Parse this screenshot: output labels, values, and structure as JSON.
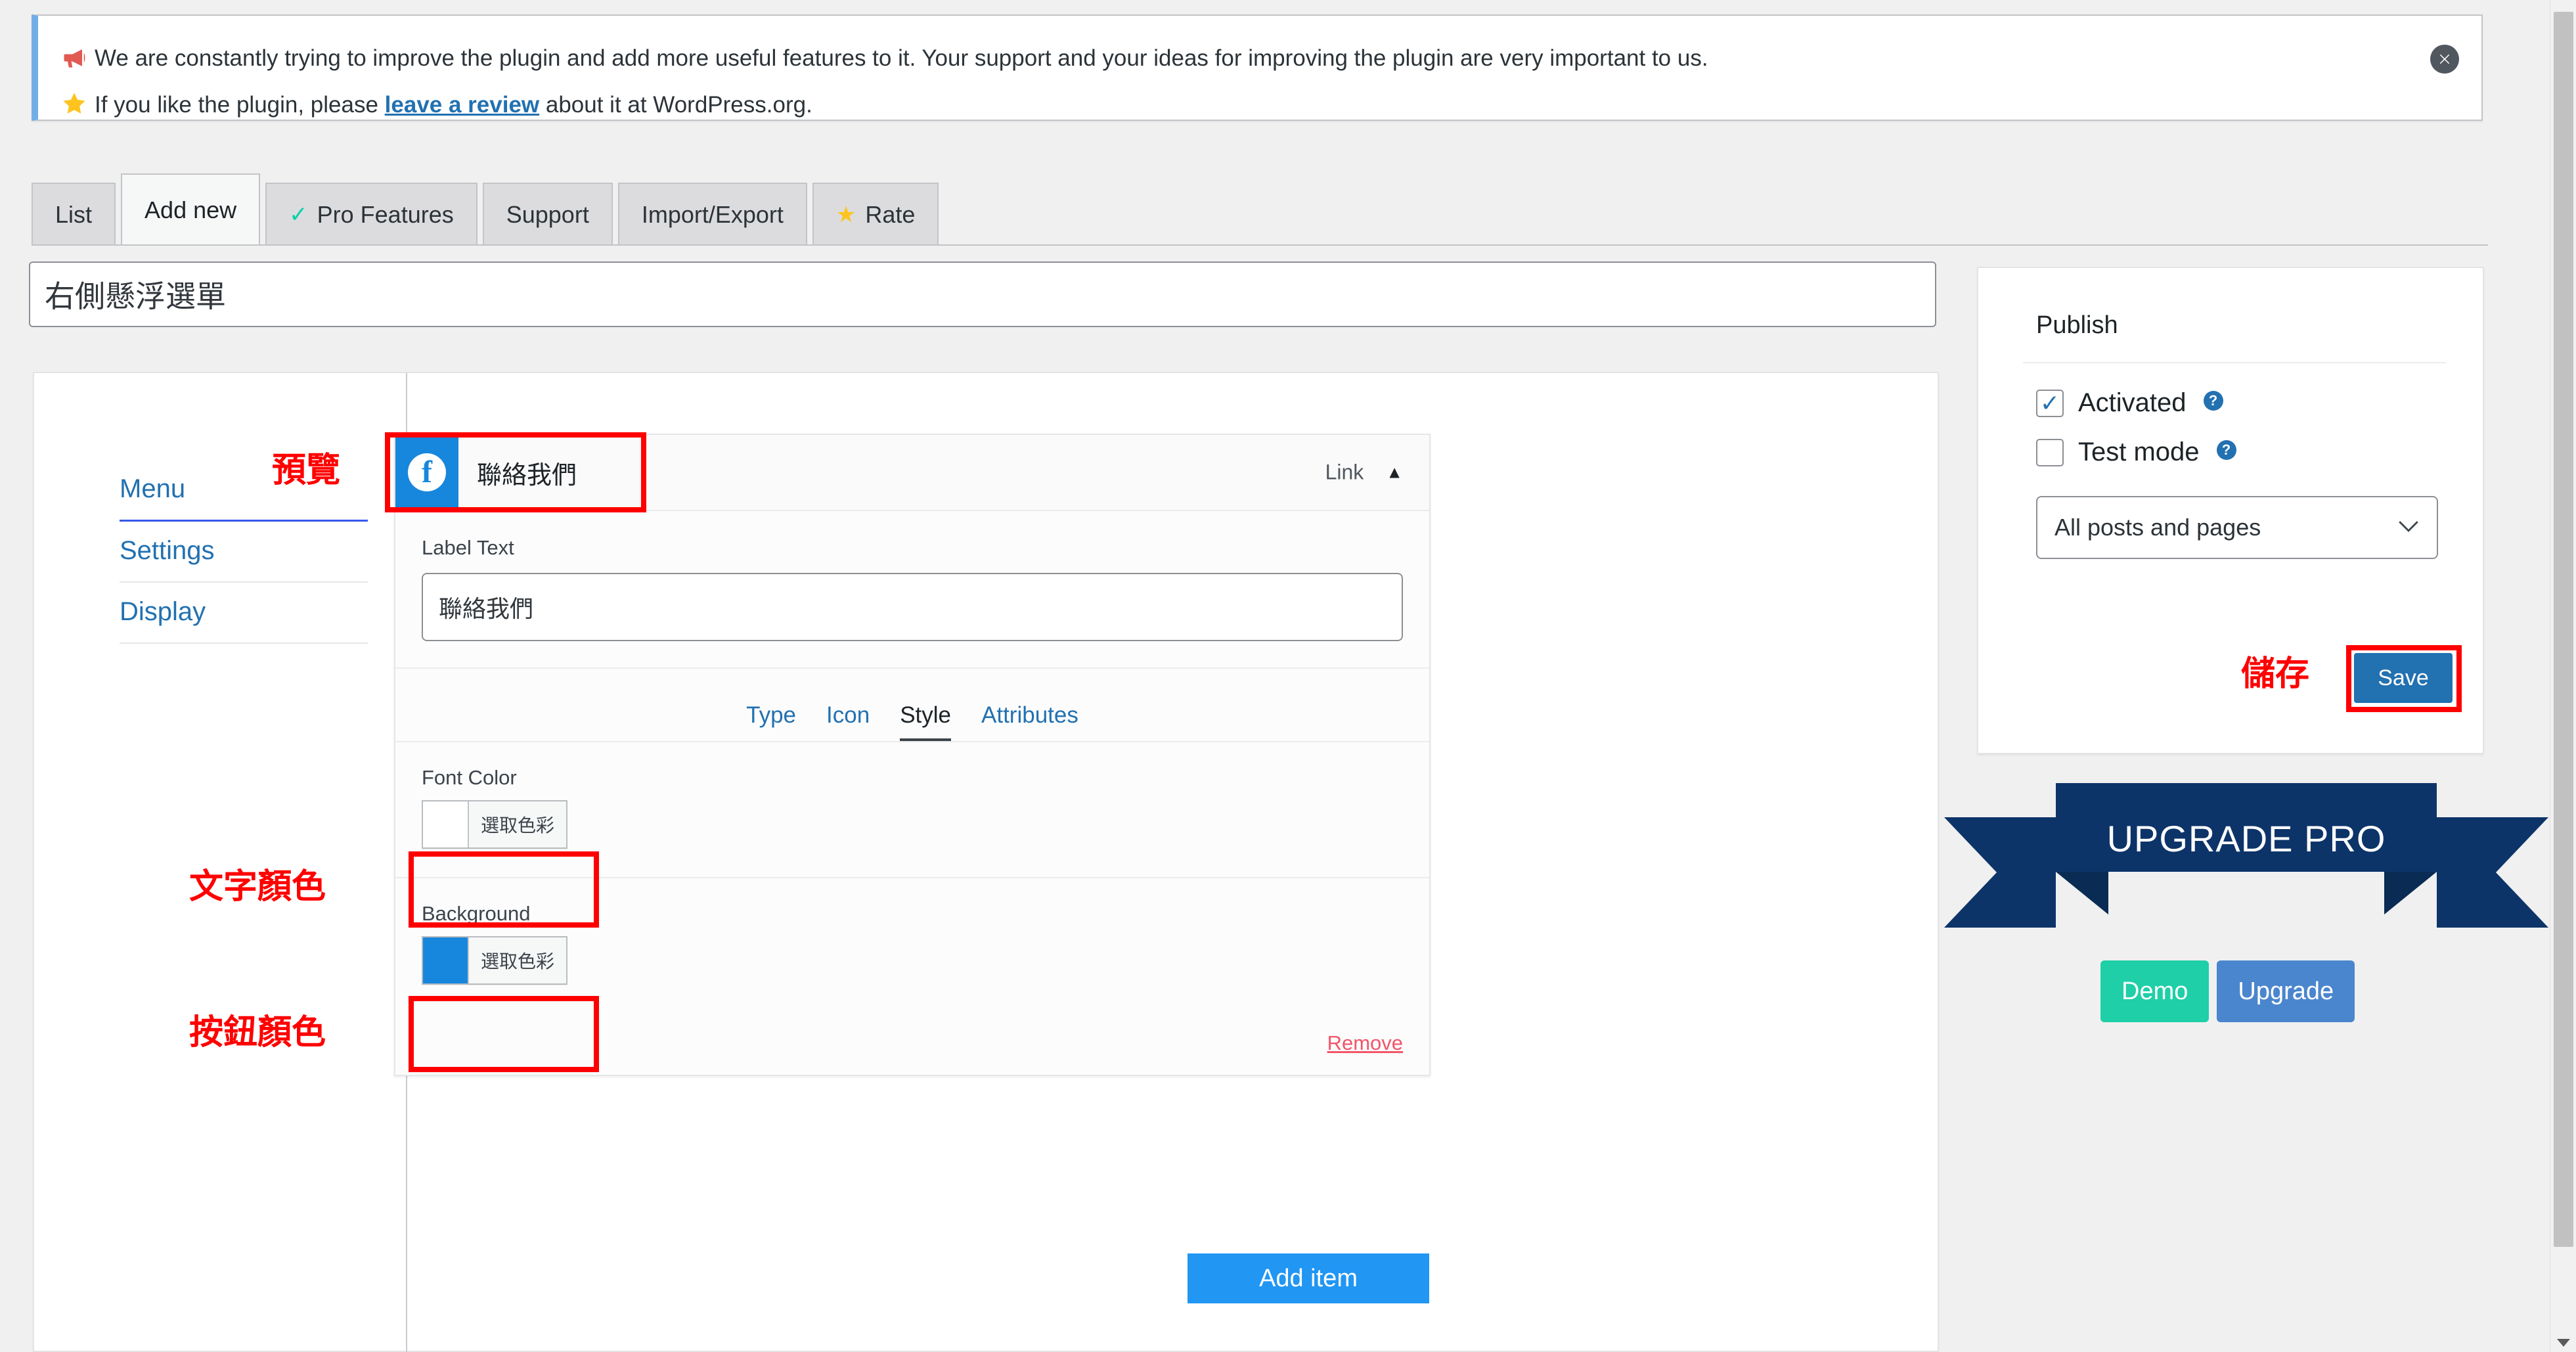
{
  "notice": {
    "line1": "We are constantly trying to improve the plugin and add more useful features to it. Your support and your ideas for improving the plugin are very important to us.",
    "line2_before": "If you like the plugin, please ",
    "line2_link": "leave a review",
    "line2_after": " about it at WordPress.org.",
    "megaphone_icon": "megaphone-icon",
    "star_icon": "star-icon",
    "close_icon": "✖",
    "accent_color": "#72aee6"
  },
  "tabs": [
    {
      "label": "List",
      "active": false,
      "icon": ""
    },
    {
      "label": "Add new",
      "active": true,
      "icon": ""
    },
    {
      "label": "Pro Features",
      "active": false,
      "icon": "✓"
    },
    {
      "label": "Support",
      "active": false,
      "icon": ""
    },
    {
      "label": "Import/Export",
      "active": false,
      "icon": ""
    },
    {
      "label": "Rate",
      "active": false,
      "icon": "★"
    }
  ],
  "title_field": {
    "value": "右側懸浮選單",
    "placeholder": "Title"
  },
  "sidebar": {
    "items": [
      {
        "label": "Menu",
        "active": true
      },
      {
        "label": "Settings",
        "active": false
      },
      {
        "label": "Display",
        "active": false
      }
    ]
  },
  "item": {
    "icon_name": "facebook-icon",
    "icon_glyph": "f",
    "icon_bg": "#1787dd",
    "title": "聯絡我們",
    "type_label": "Link",
    "collapse_caret": "▲",
    "label_text_label": "Label Text",
    "label_text_value": "聯絡我們",
    "subtabs": [
      {
        "label": "Type",
        "active": false
      },
      {
        "label": "Icon",
        "active": false
      },
      {
        "label": "Style",
        "active": true
      },
      {
        "label": "Attributes",
        "active": false
      }
    ],
    "font_color": {
      "label": "Font Color",
      "swatch": "#ffffff",
      "button": "選取色彩"
    },
    "background": {
      "label": "Background",
      "swatch": "#1787dd",
      "button": "選取色彩"
    },
    "remove_label": "Remove"
  },
  "add_item_label": "Add item",
  "publish": {
    "title": "Publish",
    "activated": {
      "label": "Activated",
      "checked": true,
      "check_glyph": "✓",
      "help_glyph": "?"
    },
    "test_mode": {
      "label": "Test mode",
      "checked": false,
      "check_glyph": "",
      "help_glyph": "?"
    },
    "scope_select": {
      "value": "All posts and pages",
      "caret": "∨"
    },
    "save_label": "Save"
  },
  "upgrade": {
    "ribbon_text": "UPGRADE PRO",
    "ribbon_color": "#0d3469",
    "demo_label": "Demo",
    "demo_color": "#1ecfa7",
    "upgrade_label": "Upgrade",
    "upgrade_color": "#4a86ce"
  },
  "annotations": {
    "preview": "預覽",
    "font_color": "文字顏色",
    "button_color": "按鈕顏色",
    "save": "儲存",
    "color": "#ff0000"
  }
}
